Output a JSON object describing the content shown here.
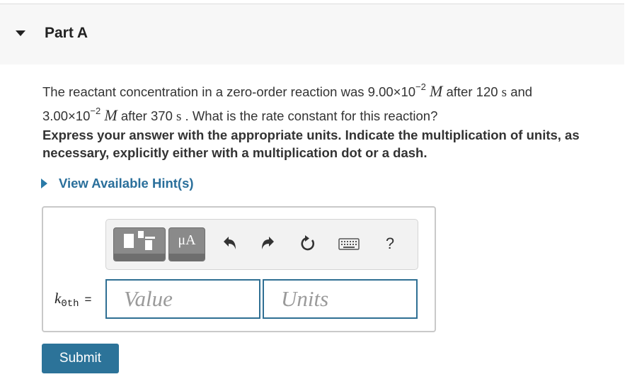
{
  "part": {
    "title": "Part A"
  },
  "question": {
    "prefix": "The reactant concentration in a zero-order reaction was ",
    "c1_mantissa": "9.00×10",
    "c1_exponent": "−2",
    "conc_unit": "M",
    "mid1": " after ",
    "t1_value": "120",
    "time_unit": "s",
    "mid2": " and",
    "c2_mantissa": "3.00×10",
    "c2_exponent": "−2",
    "t2_value": "370",
    "suffix": " . What is the rate constant for this reaction?"
  },
  "instruction": "Express your answer with the appropriate units. Indicate the multiplication of units, as necessary, explicitly either with a multiplication dot or a dash.",
  "hint": {
    "label": "View Available Hint(s)"
  },
  "toolbar": {
    "templates_icon": "templates-icon",
    "units_label": "μA",
    "undo_icon": "undo-icon",
    "redo_icon": "redo-icon",
    "reset_icon": "reset-icon",
    "keyboard_icon": "keyboard-icon",
    "help_label": "?"
  },
  "answer": {
    "var_symbol": "k",
    "var_subscript": "0th",
    "equals": "=",
    "value_placeholder": "Value",
    "units_placeholder": "Units"
  },
  "submit_label": "Submit",
  "colors": {
    "accent": "#2c7399",
    "link": "#2a6f9b",
    "field_border": "#2f6f93"
  }
}
